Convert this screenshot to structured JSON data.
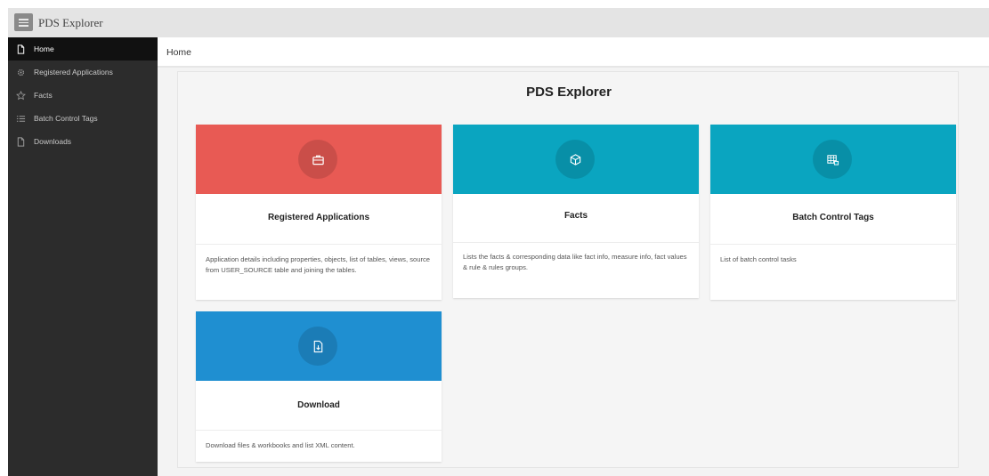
{
  "app": {
    "title": "PDS Explorer"
  },
  "sidebar": {
    "items": [
      {
        "label": "Home",
        "icon": "file-icon",
        "active": true
      },
      {
        "label": "Registered Applications",
        "icon": "gear-icon",
        "active": false
      },
      {
        "label": "Facts",
        "icon": "star-icon",
        "active": false
      },
      {
        "label": "Batch Control Tags",
        "icon": "list-icon",
        "active": false
      },
      {
        "label": "Downloads",
        "icon": "file-icon",
        "active": false
      }
    ]
  },
  "breadcrumb": "Home",
  "page": {
    "title": "PDS Explorer"
  },
  "cards": [
    {
      "title": "Registered Applications",
      "description": "Application details including properties, objects, list of tables, views, source from USER_SOURCE table and joining the tables.",
      "color": "#e85a54",
      "icon": "briefcase-icon"
    },
    {
      "title": "Facts",
      "description": "Lists the facts & corresponding data like fact info, measure info, fact values & rule & rules groups.",
      "color": "#0aa5c0",
      "icon": "cube-icon"
    },
    {
      "title": "Batch Control Tags",
      "description": "List of batch control tasks",
      "color": "#0aa5c0",
      "icon": "table-icon"
    },
    {
      "title": "Download",
      "description": "Download files & workbooks and list XML content.",
      "color": "#1f8fd1",
      "icon": "download-file-icon"
    }
  ]
}
